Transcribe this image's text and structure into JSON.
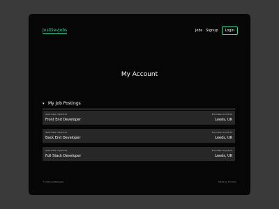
{
  "header": {
    "brand": "JustDevJobs",
    "nav": {
      "jobs": "Jobs",
      "signup": "Signup",
      "login": "Login"
    }
  },
  "main": {
    "title": "My Account",
    "section_title": "My Job Postings",
    "section_icon": "chevron-down-icon",
    "jobs": [
      {
        "start": "Start Date: 01/03/19",
        "end": "End Date: 01/03/19",
        "title": "Front End Developer",
        "location": "Leeds, UK"
      },
      {
        "start": "Start Date: 01/03/19",
        "end": "End Date: 01/03/19",
        "title": "Back End Developer",
        "location": "Leeds, UK"
      },
      {
        "start": "Start Date: 01/03/19",
        "end": "End Date: 01/03/19",
        "title": "Full Stack Developer",
        "location": "Leeds, UK"
      }
    ]
  },
  "footer": {
    "copyright": "© 2019 JustDevJobs",
    "credit": "Made by Timothy"
  },
  "colors": {
    "accent": "#3ed39b",
    "background": "#060606",
    "card": "#272727"
  }
}
